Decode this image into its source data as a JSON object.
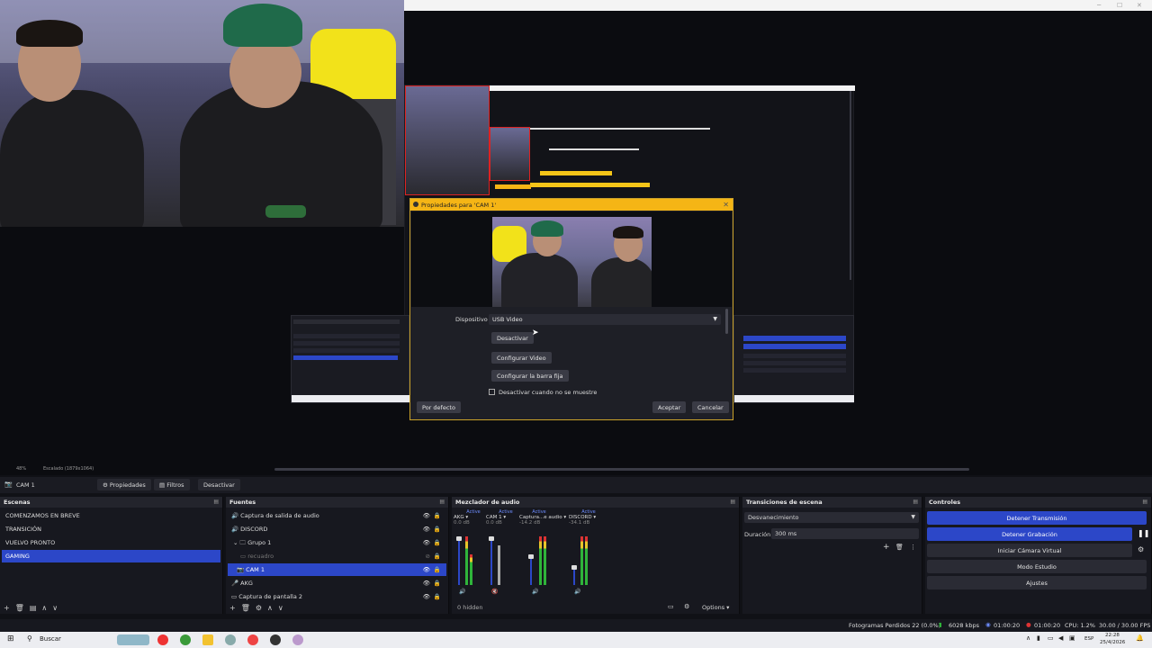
{
  "preview": {
    "zoom": "48%",
    "resolution": "Escalado (1879x1064)"
  },
  "dialog": {
    "title": "Propiedades para 'CAM 1'",
    "device_label": "Dispositivo",
    "device_value": "USB Video",
    "deactivate_button": "Desactivar",
    "configure_video_button": "Configurar Video",
    "configure_crossbar_button": "Configurar la barra fija",
    "deactivate_hidden_checkbox": "Desactivar cuando no se muestre",
    "defaults_button": "Por defecto",
    "accept_button": "Aceptar",
    "cancel_button": "Cancelar"
  },
  "source_toolbar": {
    "selected_source": "CAM 1",
    "properties": "Propiedades",
    "filters": "Filtros",
    "deactivate": "Desactivar"
  },
  "scenes": {
    "title": "Escenas",
    "items": [
      "COMENZAMOS EN BREVE",
      "TRANSICIÓN",
      "VUELVO PRONTO",
      "GAMING"
    ],
    "selected_index": 3
  },
  "sources": {
    "title": "Fuentes",
    "items": [
      {
        "label": "Captura de salida de audio",
        "icon": "speaker-icon"
      },
      {
        "label": "DISCORD",
        "icon": "speaker-icon"
      },
      {
        "label": "Grupo 1",
        "icon": "folder-icon"
      },
      {
        "label": "recuadro",
        "icon": "image-icon"
      },
      {
        "label": "CAM 1",
        "icon": "camera-icon"
      },
      {
        "label": "AKG",
        "icon": "microphone-icon"
      },
      {
        "label": "Captura de pantalla 2",
        "icon": "monitor-icon"
      }
    ],
    "selected_index": 4
  },
  "mixer": {
    "title": "Mezclador de audio",
    "channels": [
      {
        "active": "Active",
        "name": "AKG",
        "db": "0.0 dB"
      },
      {
        "active": "Active",
        "name": "CAM 1",
        "db": "0.0 dB"
      },
      {
        "active": "Active",
        "name": "Captura...e audio",
        "db": "-14.2 dB"
      },
      {
        "active": "Active",
        "name": "DISCORD",
        "db": "-34.1 dB"
      }
    ],
    "hidden": "0 hidden",
    "options": "Options"
  },
  "transitions": {
    "title": "Transiciones de escena",
    "selected": "Desvanecimiento",
    "duration_label": "Duración",
    "duration_value": "300 ms"
  },
  "controls": {
    "title": "Controles",
    "stop_stream": "Detener Transmisión",
    "stop_recording": "Detener Grabación",
    "virtual_camera": "Iniciar Cámara Virtual",
    "studio_mode": "Modo Estudio",
    "settings": "Ajustes"
  },
  "statusbar": {
    "frames_dropped": "Fotogramas Perdidos 22 (0.0%)",
    "bitrate": "6028 kbps",
    "stream_time": "01:00:20",
    "rec_time": "01:00:20",
    "cpu": "CPU: 1.2%",
    "fps": "30.00 / 30.00 FPS"
  },
  "taskbar": {
    "search": "Buscar",
    "lang": "ESP",
    "time": "22:28",
    "date": "25/4/2026"
  },
  "colors": {
    "accent_blue": "#2c47c8",
    "dialog_title": "#f5b515"
  }
}
